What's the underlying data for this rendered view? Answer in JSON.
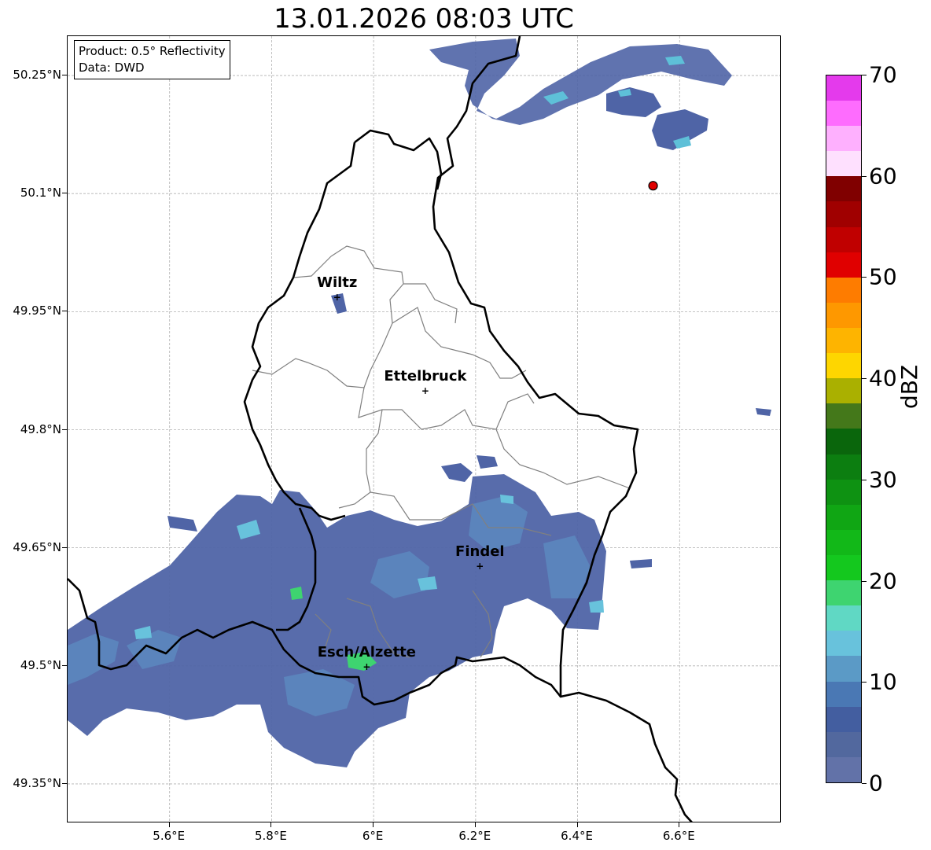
{
  "title": "13.01.2026 08:03 UTC",
  "info_box": {
    "product": "Product: 0.5° Reflectivity",
    "data": "Data: DWD"
  },
  "lat_ticks": [
    {
      "label": "50.25°N",
      "value": 50.25
    },
    {
      "label": "50.1°N",
      "value": 50.1
    },
    {
      "label": "49.95°N",
      "value": 49.95
    },
    {
      "label": "49.8°N",
      "value": 49.8
    },
    {
      "label": "49.65°N",
      "value": 49.65
    },
    {
      "label": "49.5°N",
      "value": 49.5
    },
    {
      "label": "49.35°N",
      "value": 49.35
    }
  ],
  "lon_ticks": [
    {
      "label": "5.6°E",
      "value": 5.6
    },
    {
      "label": "5.8°E",
      "value": 5.8
    },
    {
      "label": "6°E",
      "value": 6.0
    },
    {
      "label": "6.2°E",
      "value": 6.2
    },
    {
      "label": "6.4°E",
      "value": 6.4
    },
    {
      "label": "6.6°E",
      "value": 6.6
    }
  ],
  "cities": [
    {
      "name": "Wiltz",
      "lon": 5.93,
      "lat": 49.967
    },
    {
      "name": "Ettelbruck",
      "lon": 6.103,
      "lat": 49.848
    },
    {
      "name": "Findel",
      "lon": 6.21,
      "lat": 49.626
    },
    {
      "name": "Esch/Alzette",
      "lon": 5.988,
      "lat": 49.498
    }
  ],
  "radar_site": {
    "lon": 6.548,
    "lat": 50.11,
    "color": "#e00000"
  },
  "colorbar": {
    "label": "dBZ",
    "min": 0,
    "max": 70,
    "ticks": [
      "0",
      "10",
      "20",
      "30",
      "40",
      "50",
      "60",
      "70"
    ],
    "colors": [
      "#6272a8",
      "#52689e",
      "#435ea0",
      "#4a78b4",
      "#5b9ac6",
      "#68c2dc",
      "#60d8c4",
      "#3ed470",
      "#14c81e",
      "#12b818",
      "#10a614",
      "#0e9212",
      "#0c7e10",
      "#0a660c",
      "#44781a",
      "#aab000",
      "#fed600",
      "#feb400",
      "#fe9800",
      "#fe7c00",
      "#e00000",
      "#c00000",
      "#a00000",
      "#800000",
      "#fee0fe",
      "#feb0fe",
      "#fe6cfe",
      "#e43aec"
    ]
  }
}
